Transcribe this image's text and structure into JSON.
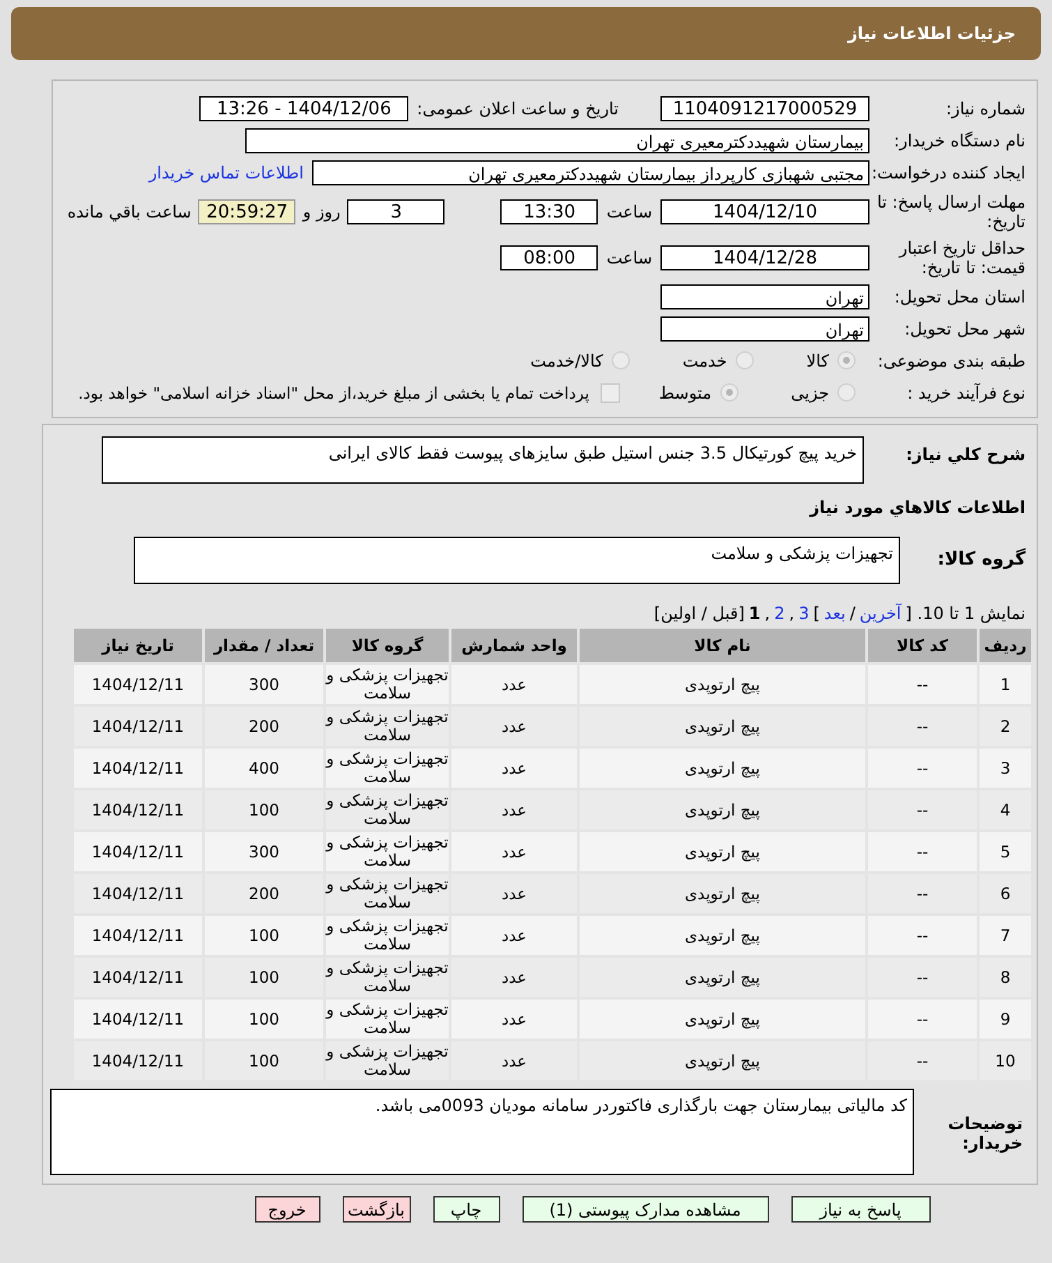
{
  "header": {
    "title": "جزئیات اطلاعات نیاز"
  },
  "need_number": {
    "label": "شماره نیاز:",
    "value": "1104091217000529"
  },
  "announce": {
    "label": "تاریخ و ساعت اعلان عمومی:",
    "value": "1404/12/06 - 13:26"
  },
  "buyer_org": {
    "label": "نام دستگاه خریدار:",
    "value": "بیمارستان شهیددکترمعیری تهران"
  },
  "creator": {
    "label": "ایجاد کننده درخواست:",
    "value": "مجتبی  شهبازی کارپرداز بیمارستان شهیددکترمعیری تهران",
    "link": "اطلاعات تماس خریدار"
  },
  "deadline": {
    "label": "مهلت ارسال پاسخ: تا تاریخ:",
    "date": "1404/12/10",
    "time_label": "ساعت",
    "time": "13:30",
    "days": "3",
    "days_label": "روز و",
    "remaining": "20:59:27",
    "remaining_label": "ساعت باقي مانده"
  },
  "validity": {
    "label": "حداقل تاریخ اعتبار قیمت: تا تاریخ:",
    "date": "1404/12/28",
    "time_label": "ساعت",
    "time": "08:00"
  },
  "province": {
    "label": "استان محل تحویل:",
    "value": "تهران"
  },
  "city": {
    "label": "شهر محل تحویل:",
    "value": "تهران"
  },
  "category": {
    "label": "طبقه بندی موضوعی:",
    "options": [
      {
        "label": "کالا",
        "selected": true
      },
      {
        "label": "خدمت",
        "selected": false
      },
      {
        "label": "کالا/خدمت",
        "selected": false
      }
    ]
  },
  "process": {
    "label": "نوع فرآیند خرید :",
    "options": [
      {
        "label": "جزیی",
        "selected": false
      },
      {
        "label": "متوسط",
        "selected": true
      }
    ],
    "checkbox": {
      "checked": false,
      "label": "پرداخت تمام یا بخشی از مبلغ خرید،از محل \"اسناد خزانه اسلامی\" خواهد بود."
    }
  },
  "description": {
    "label": "شرح کلي نیاز:",
    "value": "خرید پیچ کورتیکال 3.5 جنس استیل طبق سایزهای پیوست فقط کالای ایرانی"
  },
  "goods_title": "اطلاعات کالاهاي مورد نیاز",
  "goods_group": {
    "label": "گروه کالا:",
    "value": "تجهیزات پزشکی و سلامت"
  },
  "pagination": [
    {
      "kind": "text",
      "text": "نمایش 1 تا 10. ["
    },
    {
      "kind": "link",
      "text": "آخرین"
    },
    {
      "kind": "text",
      "text": "/"
    },
    {
      "kind": "link",
      "text": "بعد"
    },
    {
      "kind": "text",
      "text": "]"
    },
    {
      "kind": "link",
      "text": "3"
    },
    {
      "kind": "text",
      "text": ","
    },
    {
      "kind": "link",
      "text": "2"
    },
    {
      "kind": "text",
      "text": ","
    },
    {
      "kind": "current",
      "text": "1"
    },
    {
      "kind": "text",
      "text": "[قبل / اولین]"
    }
  ],
  "table": {
    "columns": [
      "ردیف",
      "کد کالا",
      "نام کالا",
      "واحد شمارش",
      "گروه کالا",
      "تعداد / مقدار",
      "تاریخ نیاز"
    ],
    "rows": [
      [
        "1",
        "--",
        "پیچ ارتوپدی",
        "عدد",
        "تجهیزات پزشکی و سلامت",
        "300",
        "1404/12/11"
      ],
      [
        "2",
        "--",
        "پیچ ارتوپدی",
        "عدد",
        "تجهیزات پزشکی و سلامت",
        "200",
        "1404/12/11"
      ],
      [
        "3",
        "--",
        "پیچ ارتوپدی",
        "عدد",
        "تجهیزات پزشکی و سلامت",
        "400",
        "1404/12/11"
      ],
      [
        "4",
        "--",
        "پیچ ارتوپدی",
        "عدد",
        "تجهیزات پزشکی و سلامت",
        "100",
        "1404/12/11"
      ],
      [
        "5",
        "--",
        "پیچ ارتوپدی",
        "عدد",
        "تجهیزات پزشکی و سلامت",
        "300",
        "1404/12/11"
      ],
      [
        "6",
        "--",
        "پیچ ارتوپدی",
        "عدد",
        "تجهیزات پزشکی و سلامت",
        "200",
        "1404/12/11"
      ],
      [
        "7",
        "--",
        "پیچ ارتوپدی",
        "عدد",
        "تجهیزات پزشکی و سلامت",
        "100",
        "1404/12/11"
      ],
      [
        "8",
        "--",
        "پیچ ارتوپدی",
        "عدد",
        "تجهیزات پزشکی و سلامت",
        "100",
        "1404/12/11"
      ],
      [
        "9",
        "--",
        "پیچ ارتوپدی",
        "عدد",
        "تجهیزات پزشکی و سلامت",
        "100",
        "1404/12/11"
      ],
      [
        "10",
        "--",
        "پیچ ارتوپدی",
        "عدد",
        "تجهیزات پزشکی و سلامت",
        "100",
        "1404/12/11"
      ]
    ]
  },
  "notes": {
    "label": "توضیحات خریدار:",
    "value": "کد مالیاتی بیمارستان جهت بارگذاری فاکتوردر سامانه مودیان 0093می باشد."
  },
  "buttons": [
    {
      "kind": "action",
      "label": "پاسخ به نیاز"
    },
    {
      "kind": "action",
      "label": "مشاهده مدارک پیوستی (1)"
    },
    {
      "kind": "action",
      "label": "چاپ"
    },
    {
      "kind": "exit",
      "label": "بازگشت"
    },
    {
      "kind": "exit",
      "label": "خروج"
    }
  ]
}
